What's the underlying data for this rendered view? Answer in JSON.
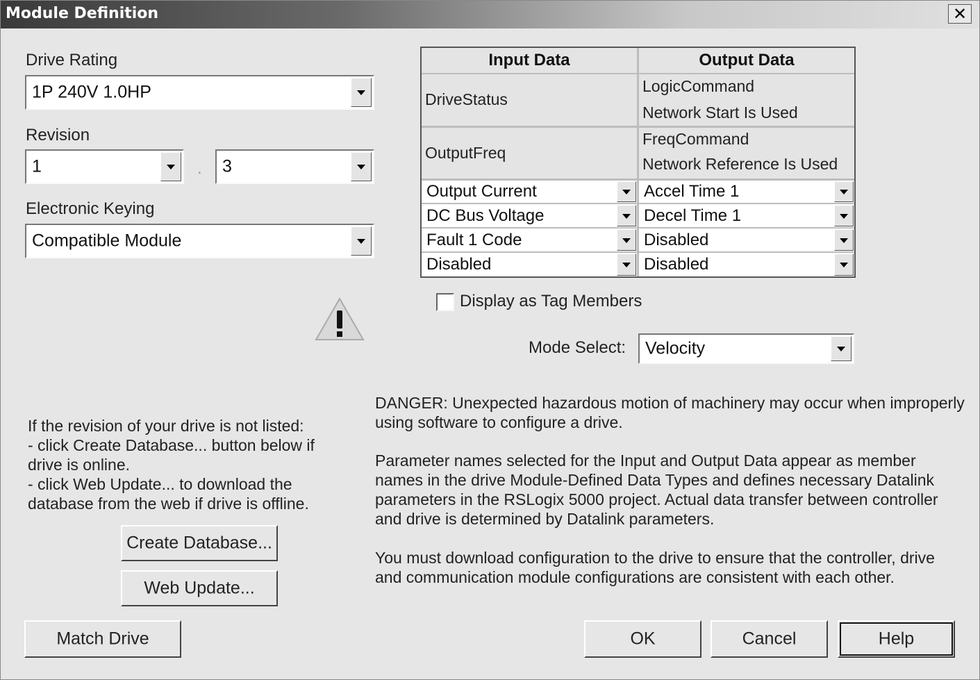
{
  "window": {
    "title": "Module Definition",
    "close_glyph": "✕"
  },
  "drive_rating": {
    "label": "Drive Rating",
    "value": "1P 240V  1.0HP"
  },
  "revision": {
    "label": "Revision",
    "major": "1",
    "separator": ".",
    "minor": "3"
  },
  "electronic_keying": {
    "label": "Electronic Keying",
    "value": "Compatible Module"
  },
  "warning_icon": "warning-triangle-icon",
  "info_text": [
    "If the revision of your drive is not listed:",
    "- click Create Database... button below if",
    "drive is online.",
    "- click Web Update... to download the",
    "database from the web if drive is offline."
  ],
  "buttons": {
    "create_database": "Create Database...",
    "web_update": "Web Update...",
    "match_drive": "Match Drive",
    "ok": "OK",
    "cancel": "Cancel",
    "help": "Help"
  },
  "datalink_table": {
    "input_header": "Input Data",
    "output_header": "Output Data",
    "fixed_rows": [
      {
        "input": "DriveStatus",
        "output_line1": "LogicCommand",
        "output_line2": "Network Start Is Used"
      },
      {
        "input": "OutputFreq",
        "output_line1": "FreqCommand",
        "output_line2": "Network Reference Is Used"
      }
    ],
    "selectable_rows": [
      {
        "input": "Output Current",
        "output": "Accel Time 1"
      },
      {
        "input": "DC Bus Voltage",
        "output": "Decel Time 1"
      },
      {
        "input": "Fault 1 Code",
        "output": "Disabled"
      },
      {
        "input": "Disabled",
        "output": "Disabled"
      }
    ]
  },
  "display_as_tag_members": {
    "label": "Display as Tag Members",
    "checked": false
  },
  "mode_select": {
    "label": "Mode Select:",
    "value": "Velocity"
  },
  "danger_text": "DANGER: Unexpected hazardous motion of machinery may occur when improperly using software to configure a drive.",
  "param_text": "Parameter names selected for the Input and Output Data appear as member names in the drive Module-Defined Data Types and defines necessary Datalink parameters in the RSLogix 5000 project.  Actual data transfer between controller and drive is determined by Datalink parameters.",
  "download_text": "You must download configuration to the drive to ensure that the controller, drive and communication module configurations are consistent with each other."
}
